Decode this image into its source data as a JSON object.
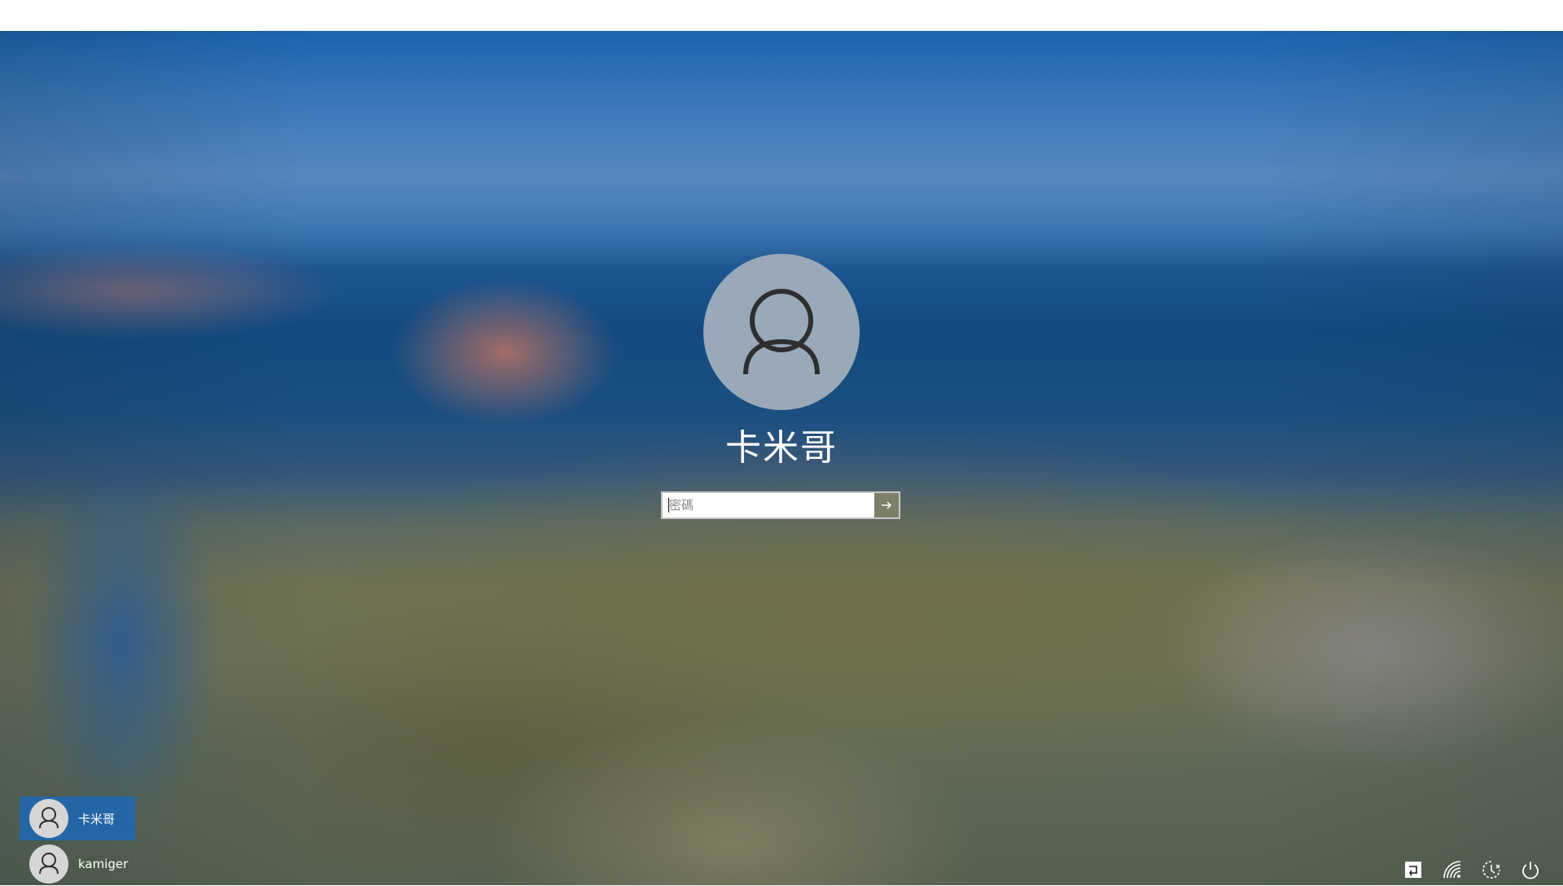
{
  "login": {
    "username": "卡米哥",
    "password_placeholder": "密碼",
    "submit_icon": "arrow-right-icon"
  },
  "users": [
    {
      "name": "卡米哥",
      "selected": true,
      "icon": "user-icon"
    },
    {
      "name": "kamiger",
      "selected": false,
      "icon": "user-icon"
    }
  ],
  "tray": {
    "icons": [
      "language-switch-icon",
      "network-icon",
      "ease-of-access-icon",
      "power-icon"
    ]
  },
  "colors": {
    "selected_user_bg": "#2466a5",
    "avatar_bg": "#9aa9b8",
    "submit_bg": "#7b8066"
  }
}
